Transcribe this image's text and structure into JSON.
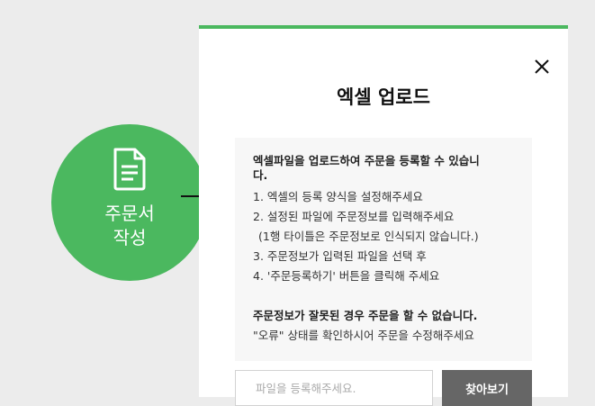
{
  "side": {
    "icon": "document-icon",
    "caption_line1": "주문서",
    "caption_line2": "작성"
  },
  "modal": {
    "accent_color": "#4bb85f",
    "close_icon": "close-icon",
    "title": "엑셀 업로드",
    "info": {
      "heading_line1": "엑셀파일을 업로드하여 주문을 등록할 수 있습니",
      "heading_line2": "다.",
      "steps": [
        "1. 엑셀의 등록 양식을 설정해주세요",
        "2. 설정된 파일에 주문정보를 입력해주세요",
        "(1행 타이틀은 주문정보로 인식되지 않습니다.)",
        "3. 주문정보가 입력된 파일을 선택 후",
        "4. '주문등록하기' 버튼을 클릭해 주세요"
      ],
      "warning": "주문정보가 잘못된 경우 주문을 할 수 없습니다.",
      "note": "\"오류\" 상태를 확인하시어 주문을 수정해주세요"
    },
    "file_input": {
      "placeholder": "파일을 등록해주세요."
    },
    "browse_button": "찾아보기"
  }
}
